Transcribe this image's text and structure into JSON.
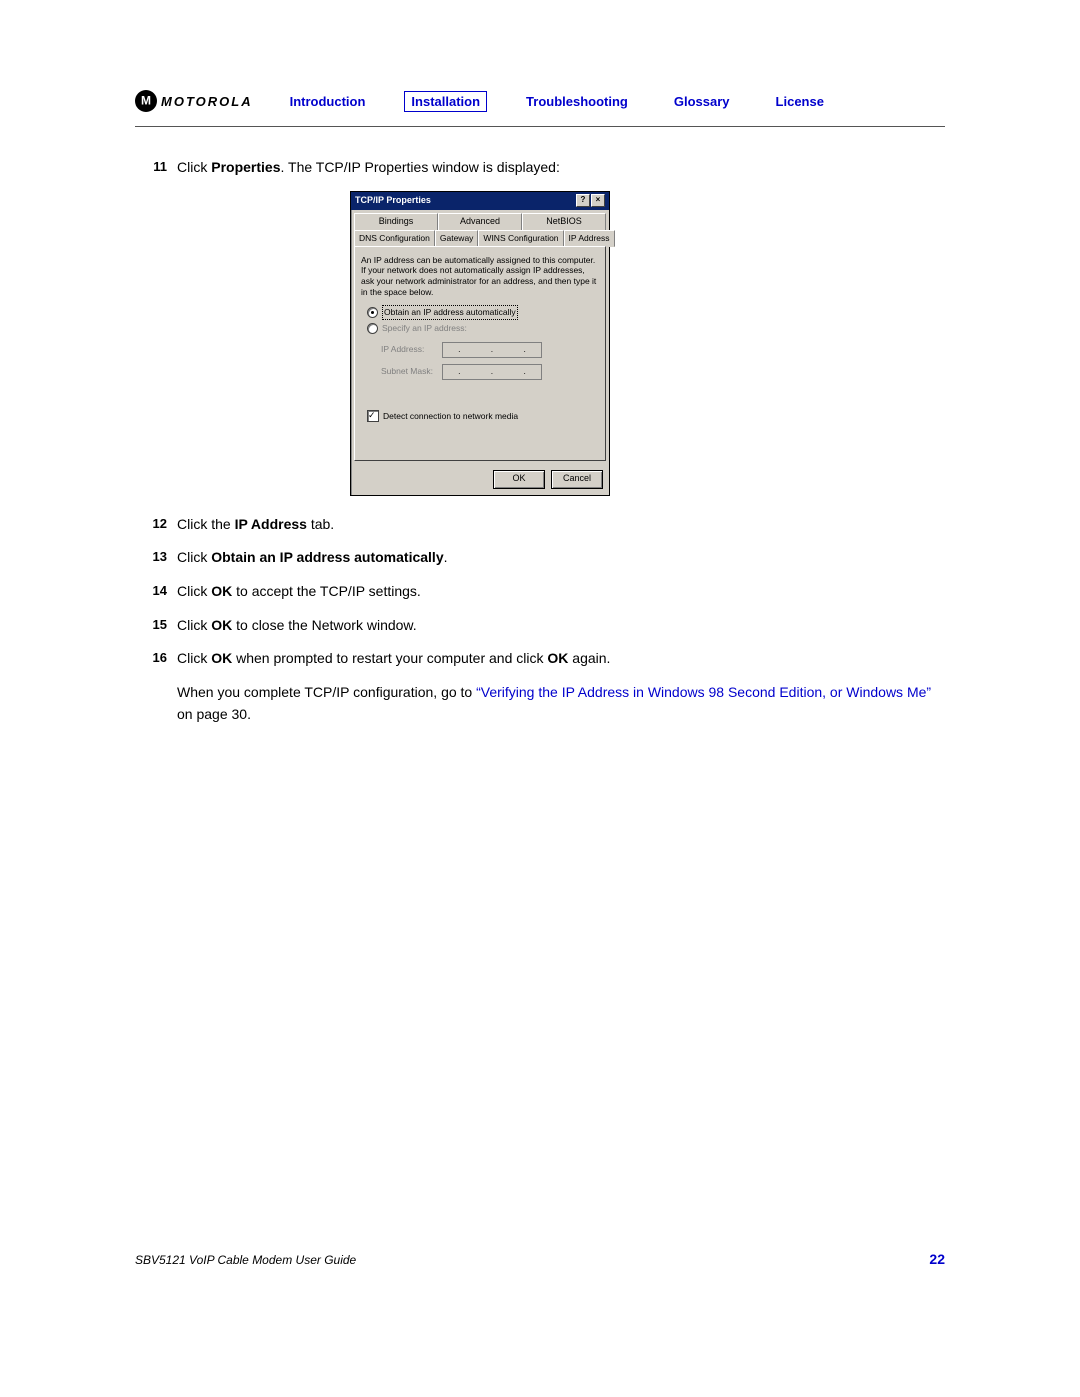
{
  "header": {
    "brand": "MOTOROLA",
    "nav": [
      "Introduction",
      "Installation",
      "Troubleshooting",
      "Glossary",
      "License"
    ],
    "active_index": 1
  },
  "steps": [
    {
      "num": "11",
      "prefix": "Click ",
      "bold1": "Properties",
      "rest": ". The TCP/IP Properties window is displayed:"
    },
    {
      "num": "12",
      "prefix": "Click the ",
      "bold1": "IP Address",
      "rest": " tab."
    },
    {
      "num": "13",
      "prefix": "Click ",
      "bold1": "Obtain an IP address automatically",
      "rest": "."
    },
    {
      "num": "14",
      "prefix": "Click ",
      "bold1": "OK",
      "rest": " to accept the TCP/IP settings."
    },
    {
      "num": "15",
      "prefix": "Click ",
      "bold1": "OK",
      "rest": " to close the Network window."
    },
    {
      "num": "16",
      "prefix": "Click ",
      "bold1": "OK",
      "rest": " when prompted to restart your computer and click ",
      "bold2": "OK",
      "rest2": " again."
    }
  ],
  "note": {
    "before_link": "When you complete TCP/IP configuration, go to ",
    "link": "“Verifying the IP Address in Windows 98 Second Edition, or Windows Me”",
    "after_link": " on page 30."
  },
  "dialog": {
    "title": "TCP/IP Properties",
    "help_btn": "?",
    "close_btn": "×",
    "tabs_row1": [
      "Bindings",
      "Advanced",
      "NetBIOS"
    ],
    "tabs_row2": [
      "DNS Configuration",
      "Gateway",
      "WINS Configuration",
      "IP Address"
    ],
    "active_tab": "IP Address",
    "desc": "An IP address can be automatically assigned to this computer. If your network does not automatically assign IP addresses, ask your network administrator for an address, and then type it in the space below.",
    "radio1": "Obtain an IP address automatically",
    "radio2": "Specify an IP address:",
    "ip_label": "IP Address:",
    "subnet_label": "Subnet Mask:",
    "checkbox": "Detect connection to network media",
    "ok": "OK",
    "cancel": "Cancel"
  },
  "footer": {
    "title": "SBV5121 VoIP Cable Modem User Guide",
    "page": "22"
  }
}
